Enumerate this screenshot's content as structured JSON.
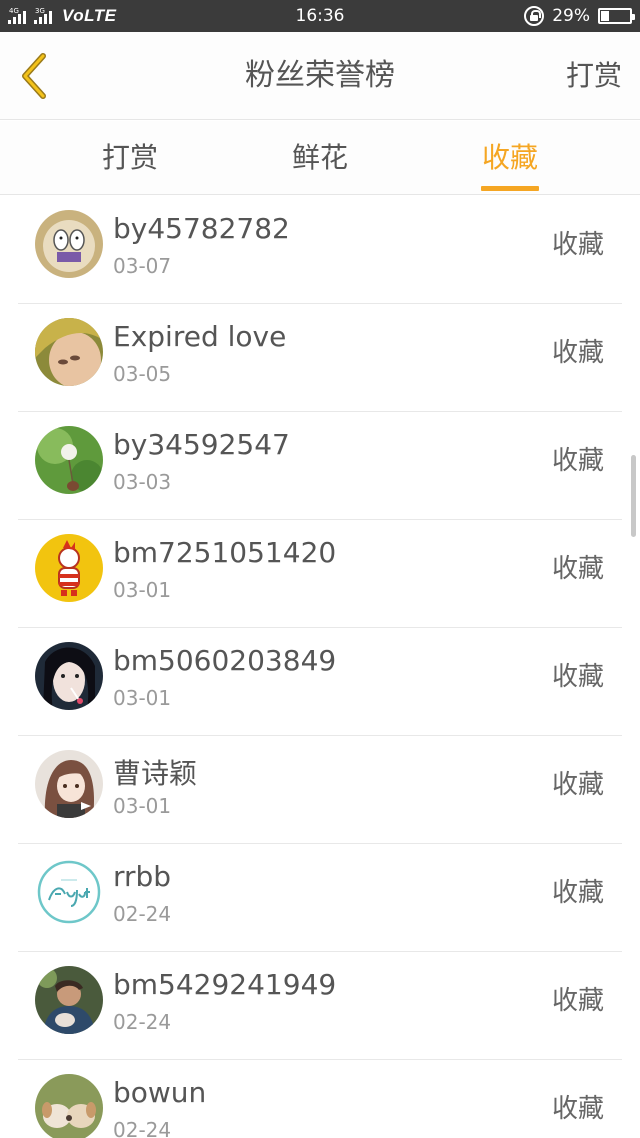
{
  "status_bar": {
    "sig1_tag": "4G",
    "sig2_tag": "3G",
    "network": "VoLTE",
    "time": "16:36",
    "battery": "29%"
  },
  "header": {
    "title": "粉丝荣誉榜",
    "action": "打赏",
    "back_icon": "chevron-left-icon"
  },
  "tabs": [
    {
      "label": "打赏",
      "active": false
    },
    {
      "label": "鲜花",
      "active": false
    },
    {
      "label": "收藏",
      "active": true
    }
  ],
  "accent_color": "#f5a623",
  "list": [
    {
      "name": "by45782782",
      "date": "03-07",
      "type": "收藏"
    },
    {
      "name": "Expired love",
      "date": "03-05",
      "type": "收藏"
    },
    {
      "name": "by34592547",
      "date": "03-03",
      "type": "收藏"
    },
    {
      "name": "bm7251051420",
      "date": "03-01",
      "type": "收藏"
    },
    {
      "name": "bm5060203849",
      "date": "03-01",
      "type": "收藏"
    },
    {
      "name": "曹诗颖",
      "date": "03-01",
      "type": "收藏"
    },
    {
      "name": "rrbb",
      "date": "02-24",
      "type": "收藏"
    },
    {
      "name": "bm5429241949",
      "date": "02-24",
      "type": "收藏"
    },
    {
      "name": "bowun",
      "date": "02-24",
      "type": "收藏"
    }
  ]
}
